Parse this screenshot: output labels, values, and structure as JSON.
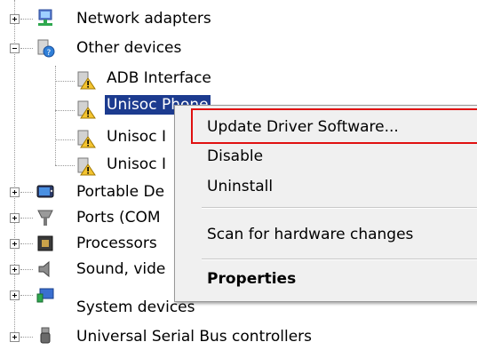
{
  "tree": {
    "items": [
      {
        "label": "Network adapters",
        "icon": "network-adapter-icon"
      },
      {
        "label": "Other devices",
        "icon": "unknown-device-icon"
      },
      {
        "label": "ADB Interface",
        "icon": "warning-device-icon"
      },
      {
        "label": "Unisoc Phone",
        "icon": "warning-device-icon"
      },
      {
        "label": "Unisoc I",
        "icon": "warning-device-icon"
      },
      {
        "label": "Unisoc I",
        "icon": "warning-device-icon"
      },
      {
        "label": "Portable De",
        "icon": "portable-device-icon"
      },
      {
        "label": "Ports (COM",
        "icon": "port-icon"
      },
      {
        "label": "Processors",
        "icon": "processor-icon"
      },
      {
        "label": "Sound, vide",
        "icon": "speaker-icon"
      },
      {
        "label": "System devices",
        "icon": "system-device-icon"
      },
      {
        "label": "Universal Serial Bus controllers",
        "icon": "usb-icon"
      }
    ]
  },
  "context_menu": {
    "update_driver": "Update Driver Software...",
    "disable": "Disable",
    "uninstall": "Uninstall",
    "scan": "Scan for hardware changes",
    "properties": "Properties"
  },
  "colors": {
    "selection": "#1c3b8f",
    "highlight_border": "#e01010"
  }
}
